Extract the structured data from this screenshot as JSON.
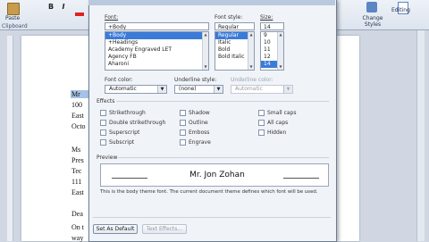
{
  "ribbon": {
    "paste_label": "Paste",
    "clipboard_label": "Clipboard",
    "bold_label": "B",
    "italic_label": "I",
    "change_styles_label": "Change Styles",
    "editing_label": "Editing"
  },
  "document": {
    "lines_top": [
      "Mr",
      "100",
      "East",
      "Octo"
    ],
    "lines_mid": [
      "Ms",
      "Pres",
      "Tec",
      "111",
      "East"
    ],
    "lines_bottom": [
      "Dea",
      "On t",
      "way"
    ]
  },
  "font_dialog": {
    "font_label": "Font:",
    "font_value": "+Body",
    "font_list": [
      "+Body",
      "+Headings",
      "Academy Engraved LET",
      "Agency FB",
      "Aharoni"
    ],
    "font_selected": "+Body",
    "style_label": "Font style:",
    "style_value": "Regular",
    "style_list": [
      "Regular",
      "Italic",
      "Bold",
      "Bold Italic"
    ],
    "style_selected": "Regular",
    "size_label": "Size:",
    "size_value": "14",
    "size_list": [
      "9",
      "10",
      "11",
      "12",
      "14"
    ],
    "size_selected": "14",
    "font_color_label": "Font color:",
    "font_color_value": "Automatic",
    "underline_style_label": "Underline style:",
    "underline_style_value": "(none)",
    "underline_color_label": "Underline color:",
    "underline_color_value": "Automatic",
    "effects_title": "Effects",
    "effects_col1": [
      "Strikethrough",
      "Double strikethrough",
      "Superscript",
      "Subscript"
    ],
    "effects_col2": [
      "Shadow",
      "Outline",
      "Emboss",
      "Engrave"
    ],
    "effects_col3": [
      "Small caps",
      "All caps",
      "Hidden"
    ],
    "preview_title": "Preview",
    "preview_text": "Mr. Jon Zohan",
    "preview_note": "This is the body theme font. The current document theme defines which font will be used.",
    "set_default_label": "Set As Default",
    "text_effects_label": "Text Effects..."
  }
}
